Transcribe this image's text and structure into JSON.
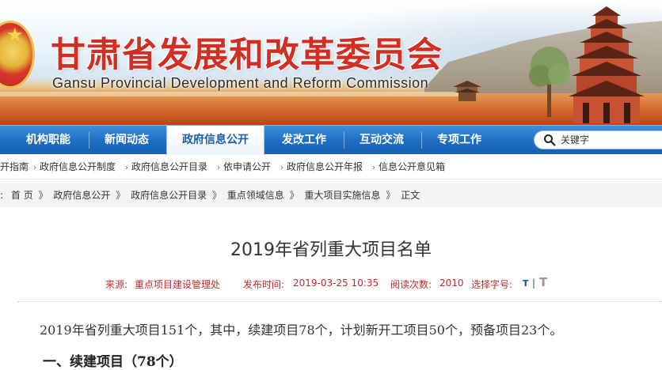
{
  "banner": {
    "title": "甘肃省发展和改革委员会",
    "subtitle": "Gansu Provincial Development and Reform Commission",
    "emblem_icon": "★"
  },
  "nav": {
    "items": [
      {
        "label": "机构职能"
      },
      {
        "label": "新闻动态"
      },
      {
        "label": "政府信息公开",
        "active": true
      },
      {
        "label": "发改工作"
      },
      {
        "label": "互动交流"
      },
      {
        "label": "专项工作"
      }
    ],
    "search_placeholder": "关键字"
  },
  "subnav": {
    "items": [
      {
        "label": "开指南"
      },
      {
        "label": "政府信息公开制度"
      },
      {
        "label": "政府信息公开目录"
      },
      {
        "label": "依申请公开"
      },
      {
        "label": "政府信息公开年报"
      },
      {
        "label": "信息公开意见箱"
      }
    ]
  },
  "breadcrumb": {
    "lead": ":",
    "items": [
      "首 页",
      "政府信息公开",
      "政府信息公开目录",
      "重点领域信息",
      "重大项目实施信息",
      "正文"
    ],
    "separator": "》"
  },
  "article": {
    "title": "2019年省列重大项目名单",
    "source_label": "来源:",
    "source_value": "重点项目建设管理处",
    "date_label": "发布时间:",
    "date_value": "2019-03-25 10:35",
    "views_label": "阅读次数:",
    "views_value": "2010",
    "font_label": "选择字号:",
    "font_small": "T",
    "font_bar": "|",
    "font_large": "T",
    "paragraph": "2019年省列重大项目151个，其中，续建项目78个，计划新开工项目50个，预备项目23个。",
    "section_heading": "一、续建项目（78个）"
  },
  "colors": {
    "nav_blue": "#1f6fc6",
    "title_red": "#d12f24",
    "meta_red": "#c1272d"
  }
}
